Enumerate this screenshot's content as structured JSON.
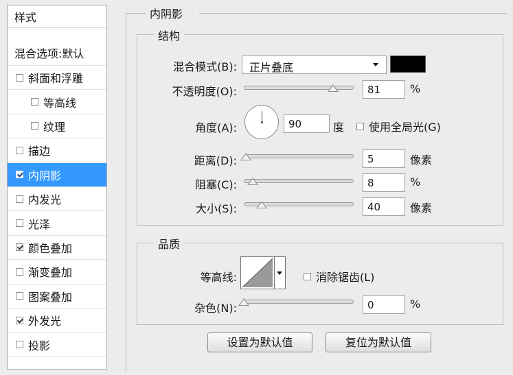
{
  "styles_panel": {
    "header": "样式",
    "blending_options": "混合选项:默认",
    "items": [
      {
        "label": "斜面和浮雕",
        "checked": false,
        "selected": false,
        "indent": false
      },
      {
        "label": "等高线",
        "checked": false,
        "selected": false,
        "indent": true
      },
      {
        "label": "纹理",
        "checked": false,
        "selected": false,
        "indent": true
      },
      {
        "label": "描边",
        "checked": false,
        "selected": false,
        "indent": false
      },
      {
        "label": "内阴影",
        "checked": true,
        "selected": true,
        "indent": false
      },
      {
        "label": "内发光",
        "checked": false,
        "selected": false,
        "indent": false
      },
      {
        "label": "光泽",
        "checked": false,
        "selected": false,
        "indent": false
      },
      {
        "label": "颜色叠加",
        "checked": true,
        "selected": false,
        "indent": false
      },
      {
        "label": "渐变叠加",
        "checked": false,
        "selected": false,
        "indent": false
      },
      {
        "label": "图案叠加",
        "checked": false,
        "selected": false,
        "indent": false
      },
      {
        "label": "外发光",
        "checked": true,
        "selected": false,
        "indent": false
      },
      {
        "label": "投影",
        "checked": false,
        "selected": false,
        "indent": false
      }
    ]
  },
  "inner_shadow": {
    "title": "内阴影",
    "structure": {
      "legend": "结构",
      "blend_mode_label": "混合模式(B):",
      "blend_mode_value": "正片叠底",
      "shadow_color": "#000000",
      "opacity_label": "不透明度(O):",
      "opacity_value": "81",
      "opacity_unit": "%",
      "opacity_fraction": 0.81,
      "angle_label": "角度(A):",
      "angle_value": "90",
      "angle_unit": "度",
      "global_light_label": "使用全局光(G)",
      "global_light_checked": false,
      "distance_label": "距离(D):",
      "distance_value": "5",
      "distance_unit": "像素",
      "distance_fraction": 0.02,
      "choke_label": "阻塞(C):",
      "choke_value": "8",
      "choke_unit": "%",
      "choke_fraction": 0.08,
      "size_label": "大小(S):",
      "size_value": "40",
      "size_unit": "像素",
      "size_fraction": 0.16
    },
    "quality": {
      "legend": "品质",
      "contour_label": "等高线:",
      "antialias_label": "消除锯齿(L)",
      "antialias_checked": false,
      "noise_label": "杂色(N):",
      "noise_value": "0",
      "noise_unit": "%",
      "noise_fraction": 0.0
    },
    "buttons": {
      "make_default": "设置为默认值",
      "reset_default": "复位为默认值"
    }
  },
  "colors": {
    "selection": "#3399ff",
    "background": "#ececec"
  }
}
